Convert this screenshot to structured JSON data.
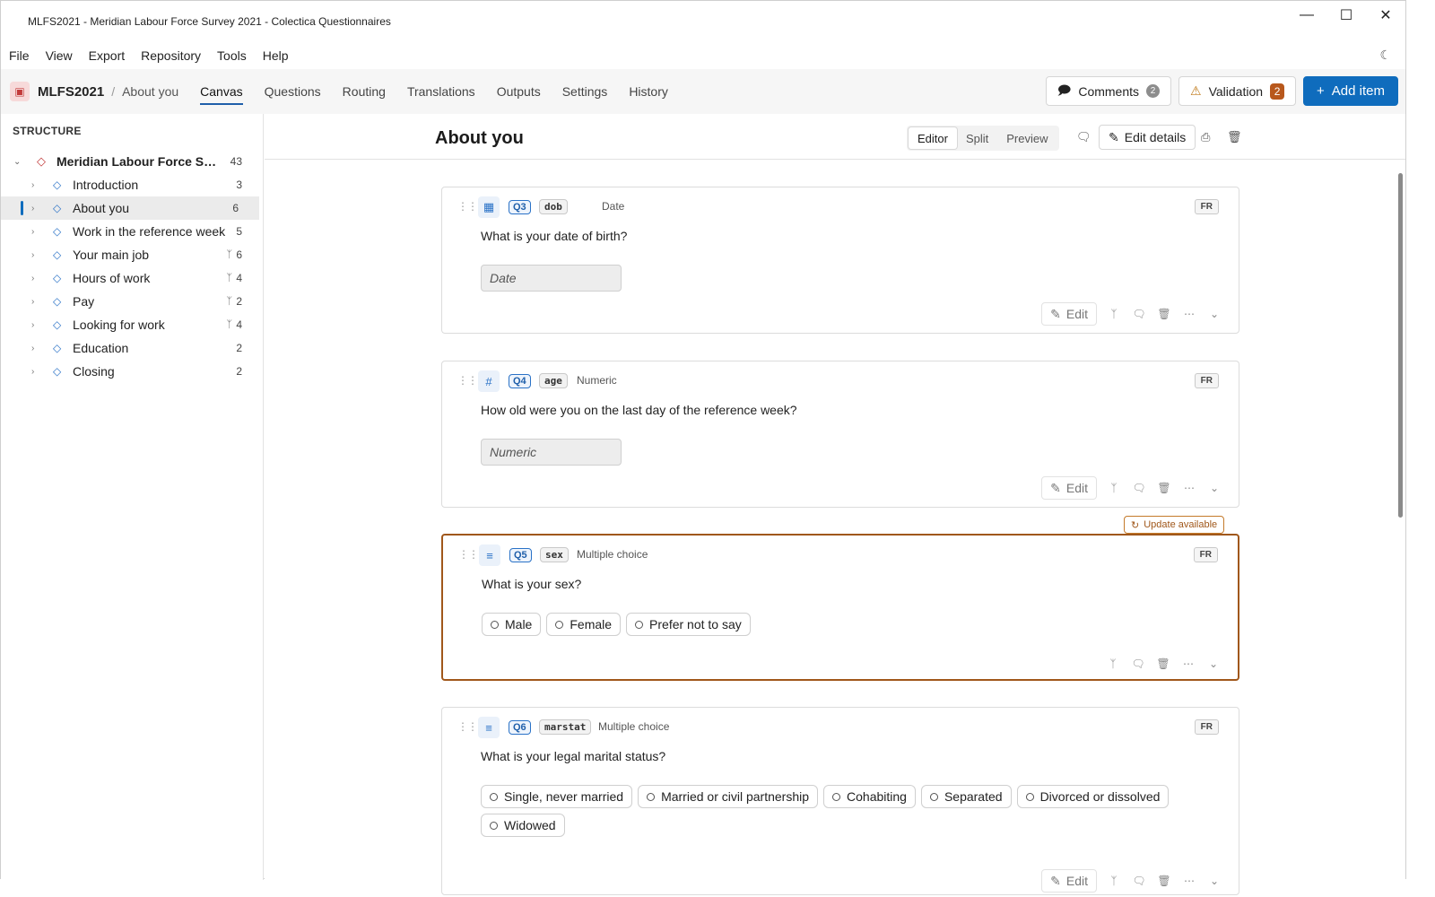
{
  "window": {
    "title": "MLFS2021 - Meridian Labour Force Survey 2021 - Colectica Questionnaires",
    "controls": [
      "minimize",
      "maximize",
      "close"
    ]
  },
  "menu": [
    "File",
    "View",
    "Export",
    "Repository",
    "Tools",
    "Help"
  ],
  "toolbar": {
    "project": "MLFS2021",
    "current_section": "About you",
    "tabs": [
      "Canvas",
      "Questions",
      "Routing",
      "Translations",
      "Outputs",
      "Settings",
      "History"
    ],
    "active_tab": "Canvas",
    "comments_label": "Comments",
    "comments_count": "2",
    "validation_label": "Validation",
    "validation_count": "2",
    "add_item_label": "Add item"
  },
  "sidebar": {
    "heading": "STRUCTURE",
    "root": {
      "label": "Meridian Labour Force Sur...",
      "count": "43"
    },
    "items": [
      {
        "label": "Introduction",
        "count": "3",
        "routing": false,
        "selected": false
      },
      {
        "label": "About you",
        "count": "6",
        "routing": false,
        "selected": true
      },
      {
        "label": "Work in the reference week",
        "count": "5",
        "routing": false,
        "selected": false
      },
      {
        "label": "Your main job",
        "count": "6",
        "routing": true,
        "selected": false
      },
      {
        "label": "Hours of work",
        "count": "4",
        "routing": true,
        "selected": false
      },
      {
        "label": "Pay",
        "count": "2",
        "routing": true,
        "selected": false
      },
      {
        "label": "Looking for work",
        "count": "4",
        "routing": true,
        "selected": false
      },
      {
        "label": "Education",
        "count": "2",
        "routing": false,
        "selected": false
      },
      {
        "label": "Closing",
        "count": "2",
        "routing": false,
        "selected": false
      }
    ]
  },
  "main": {
    "title": "About you",
    "view_modes": [
      "Editor",
      "Split",
      "Preview"
    ],
    "active_view": "Editor",
    "edit_details_label": "Edit details",
    "update_badge": "Update available",
    "questions": [
      {
        "num": "Q3",
        "var": "dob",
        "type": "Date",
        "text": "What is your date of birth?",
        "lang": "FR",
        "placeholder": "Date",
        "edit_label": "Edit"
      },
      {
        "num": "Q4",
        "var": "age",
        "type": "Numeric",
        "text": "How old were you on the last day of the reference week?",
        "lang": "FR",
        "placeholder": "Numeric",
        "edit_label": "Edit"
      },
      {
        "num": "Q5",
        "var": "sex",
        "type": "Multiple choice",
        "text": "What is your sex?",
        "lang": "FR",
        "options": [
          "Male",
          "Female",
          "Prefer not to say"
        ]
      },
      {
        "num": "Q6",
        "var": "marstat",
        "type": "Multiple choice",
        "text": "What is your legal marital status?",
        "lang": "FR",
        "options": [
          "Single, never married",
          "Married or civil partnership",
          "Cohabiting",
          "Separated",
          "Divorced or dissolved",
          "Widowed"
        ],
        "edit_label": "Edit"
      }
    ]
  },
  "colors": {
    "accent": "#0f6cbd",
    "update_border": "#a0571a",
    "validation_badge": "#b8581c"
  }
}
